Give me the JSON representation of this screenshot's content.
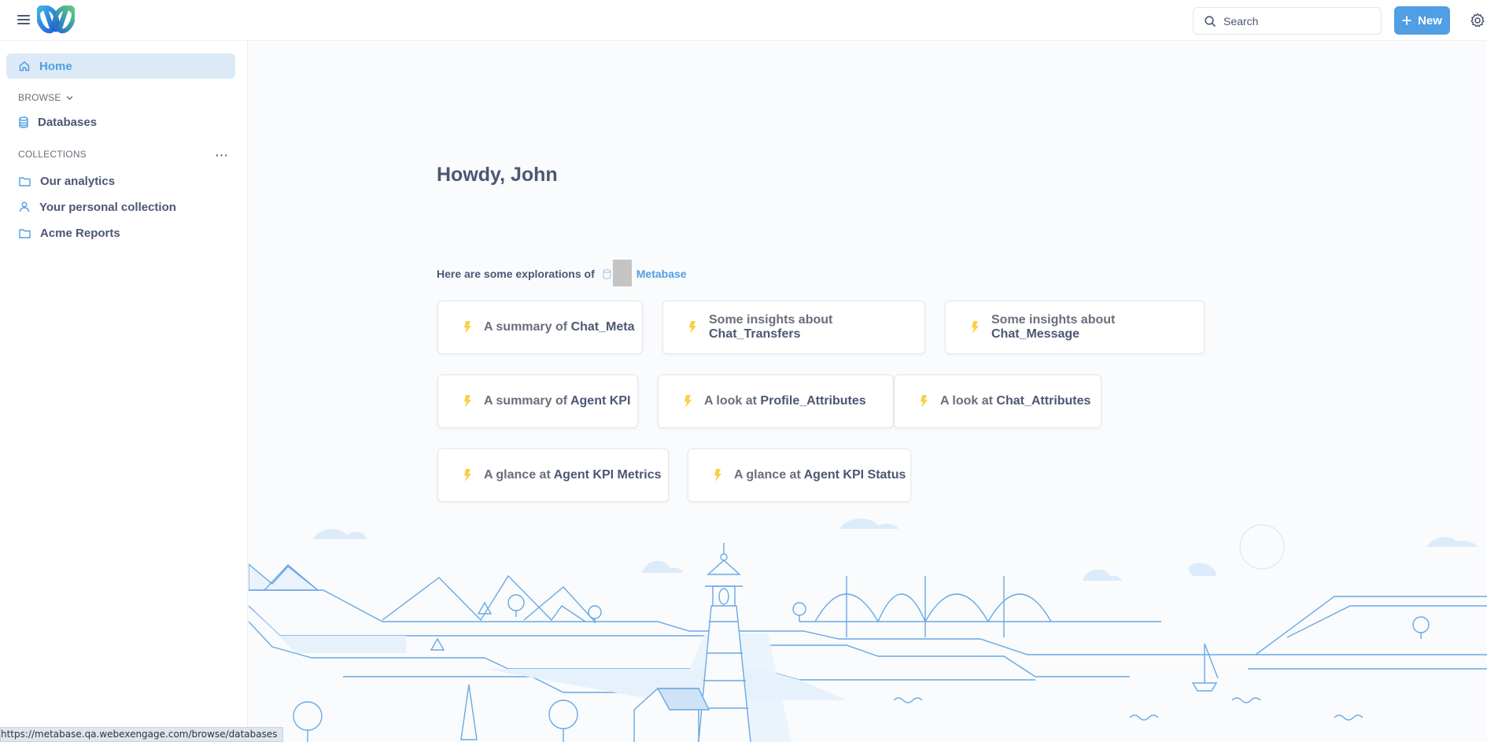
{
  "header": {
    "search_label": "Search",
    "new_label": "New"
  },
  "sidebar": {
    "home_label": "Home",
    "browse_label": "BROWSE",
    "browse_items": [
      {
        "label": "Databases"
      }
    ],
    "collections_label": "COLLECTIONS",
    "collections_menu": "···",
    "collection_items": [
      {
        "label": "Our analytics",
        "icon": "folder-icon"
      },
      {
        "label": "Your personal collection",
        "icon": "person-icon"
      },
      {
        "label": "Acme Reports",
        "icon": "folder-icon"
      }
    ]
  },
  "main": {
    "greeting": "Howdy, John",
    "explorations_prefix": "Here are some explorations of",
    "database_name": "Metabase",
    "cards": [
      {
        "prefix": "A summary of",
        "table": "Chat_Meta"
      },
      {
        "prefix": "Some insights about",
        "table": "Chat_Transfers"
      },
      {
        "prefix": "Some insights about",
        "table": "Chat_Message"
      },
      {
        "prefix": "A summary of",
        "table": "Agent KPI"
      },
      {
        "prefix": "A look at",
        "table": "Profile_Attributes"
      },
      {
        "prefix": "A look at",
        "table": "Chat_Attributes"
      },
      {
        "prefix": "A glance at",
        "table": "Agent KPI Metrics"
      },
      {
        "prefix": "A glance at",
        "table": "Agent KPI Status"
      }
    ]
  },
  "status_url": "https://metabase.qa.webexengage.com/browse/databases",
  "colors": {
    "brand": "#509ee3",
    "text": "#4c5773",
    "bolt": "#f9cf48",
    "home_bg": "#dce9f6"
  }
}
